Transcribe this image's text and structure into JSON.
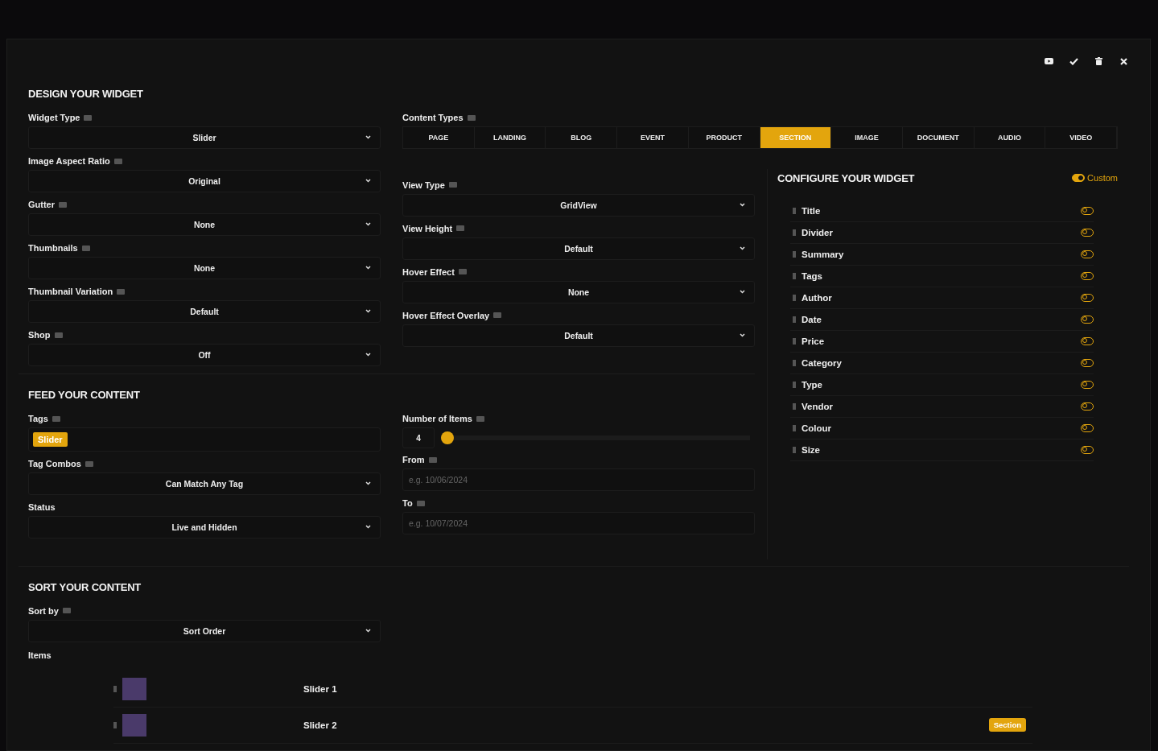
{
  "toolbar": [
    {
      "kind": "video"
    },
    {
      "kind": "check"
    },
    {
      "kind": "trash"
    },
    {
      "kind": "close"
    }
  ],
  "design": {
    "title": "DESIGN YOUR WIDGET",
    "left_fields": [
      {
        "label": "Widget Type",
        "help": true,
        "value": "Slider"
      },
      {
        "label": "Image Aspect Ratio",
        "help": true,
        "value": "Original"
      },
      {
        "label": "Gutter",
        "help": true,
        "value": "None"
      },
      {
        "label": "Thumbnails",
        "help": true,
        "value": "None"
      },
      {
        "label": "Thumbnail Variation",
        "help": true,
        "value": "Default"
      },
      {
        "label": "Shop",
        "help": true,
        "value": "Off"
      }
    ],
    "content_types": {
      "label": "Content Types",
      "help": true,
      "tabs": [
        {
          "label": "PAGE",
          "selected": false
        },
        {
          "label": "LANDING",
          "selected": false
        },
        {
          "label": "BLOG",
          "selected": false
        },
        {
          "label": "EVENT",
          "selected": false
        },
        {
          "label": "PRODUCT",
          "selected": false
        },
        {
          "label": "SECTION",
          "selected": true
        },
        {
          "label": "IMAGE",
          "selected": false
        },
        {
          "label": "DOCUMENT",
          "selected": false
        },
        {
          "label": "AUDIO",
          "selected": false
        },
        {
          "label": "VIDEO",
          "selected": false
        }
      ]
    },
    "right_fields": [
      {
        "label": "View Type",
        "help": true,
        "value": "GridView"
      },
      {
        "label": "View Height",
        "help": true,
        "value": "Default"
      },
      {
        "label": "Hover Effect",
        "help": true,
        "value": "None"
      },
      {
        "label": "Hover Effect Overlay",
        "help": true,
        "value": "Default"
      }
    ]
  },
  "configure": {
    "title": "CONFIGURE YOUR WIDGET",
    "custom": {
      "label": "Custom",
      "on": true
    },
    "items": [
      {
        "label": "Title",
        "on": false
      },
      {
        "label": "Divider",
        "on": false
      },
      {
        "label": "Summary",
        "on": false
      },
      {
        "label": "Tags",
        "on": false
      },
      {
        "label": "Author",
        "on": false
      },
      {
        "label": "Date",
        "on": false
      },
      {
        "label": "Price",
        "on": false
      },
      {
        "label": "Category",
        "on": false
      },
      {
        "label": "Type",
        "on": false
      },
      {
        "label": "Vendor",
        "on": false
      },
      {
        "label": "Colour",
        "on": false
      },
      {
        "label": "Size",
        "on": false
      }
    ]
  },
  "feed": {
    "title": "FEED YOUR CONTENT",
    "tags": {
      "label": "Tags",
      "help": true,
      "chips": [
        "Slider"
      ]
    },
    "left_fields": [
      {
        "label": "Tag Combos",
        "help": true,
        "value": "Can Match Any Tag"
      },
      {
        "label": "Status",
        "help": false,
        "value": "Live and Hidden"
      }
    ],
    "number_of_items": {
      "label": "Number of Items",
      "help": true,
      "value": "4",
      "level": 0
    },
    "dates": [
      {
        "label": "From",
        "help": true,
        "placeholder": "e.g. 10/06/2024"
      },
      {
        "label": "To",
        "help": true,
        "placeholder": "e.g. 10/07/2024"
      }
    ]
  },
  "sort": {
    "title": "SORT YOUR CONTENT",
    "sort_by": {
      "label": "Sort by",
      "help": true,
      "value": "Sort Order"
    },
    "items_label": "Items",
    "items": [
      {
        "name": "Slider 1"
      },
      {
        "name": "Slider 2",
        "badge": "Section"
      }
    ]
  }
}
